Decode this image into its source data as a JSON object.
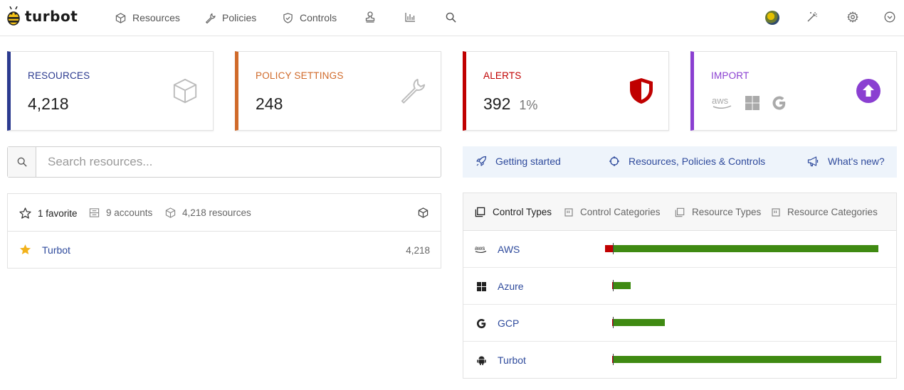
{
  "nav": {
    "logo_text": "turbot",
    "items": [
      {
        "label": "Resources",
        "icon": "cube-icon"
      },
      {
        "label": "Policies",
        "icon": "wrench-icon"
      },
      {
        "label": "Controls",
        "icon": "shield-check-icon"
      }
    ],
    "icons": [
      "stamp-icon",
      "bar-chart-icon",
      "search-icon",
      "avatar",
      "magic-wand-icon",
      "gear-icon",
      "chevron-down-circle-icon"
    ]
  },
  "cards": {
    "resources": {
      "label": "RESOURCES",
      "value": "4,218",
      "color": "#2b3a8f"
    },
    "policy": {
      "label": "POLICY SETTINGS",
      "value": "248",
      "color": "#d06a2a"
    },
    "alerts": {
      "label": "ALERTS",
      "value": "392",
      "sub": "1%",
      "color": "#c00000"
    },
    "import": {
      "label": "IMPORT",
      "color": "#8a3fd1",
      "providers": [
        "aws",
        "windows",
        "google"
      ]
    }
  },
  "search": {
    "placeholder": "Search resources..."
  },
  "quicklinks": {
    "getting_started": "Getting started",
    "rpc": "Resources, Policies & Controls",
    "whats_new": "What's new?"
  },
  "favorites": {
    "count_label": "1 favorite",
    "accounts_label": "9 accounts",
    "resources_label": "4,218 resources",
    "items": [
      {
        "name": "Turbot",
        "count": "4,218"
      }
    ]
  },
  "controls": {
    "tabs": [
      "Control Types",
      "Control Categories",
      "Resource Types",
      "Resource Categories"
    ],
    "active_tab": 0,
    "rows": [
      {
        "label": "AWS",
        "icon": "aws-icon",
        "alarm_fraction": 0.03,
        "ok_fraction": 0.93
      },
      {
        "label": "Azure",
        "icon": "windows-icon",
        "alarm_fraction": 0.005,
        "ok_fraction": 0.06
      },
      {
        "label": "GCP",
        "icon": "google-icon",
        "alarm_fraction": 0.005,
        "ok_fraction": 0.18
      },
      {
        "label": "Turbot",
        "icon": "android-icon",
        "alarm_fraction": 0.005,
        "ok_fraction": 0.94
      }
    ],
    "colors": {
      "alarm": "#c00000",
      "ok": "#3f8a12"
    }
  }
}
